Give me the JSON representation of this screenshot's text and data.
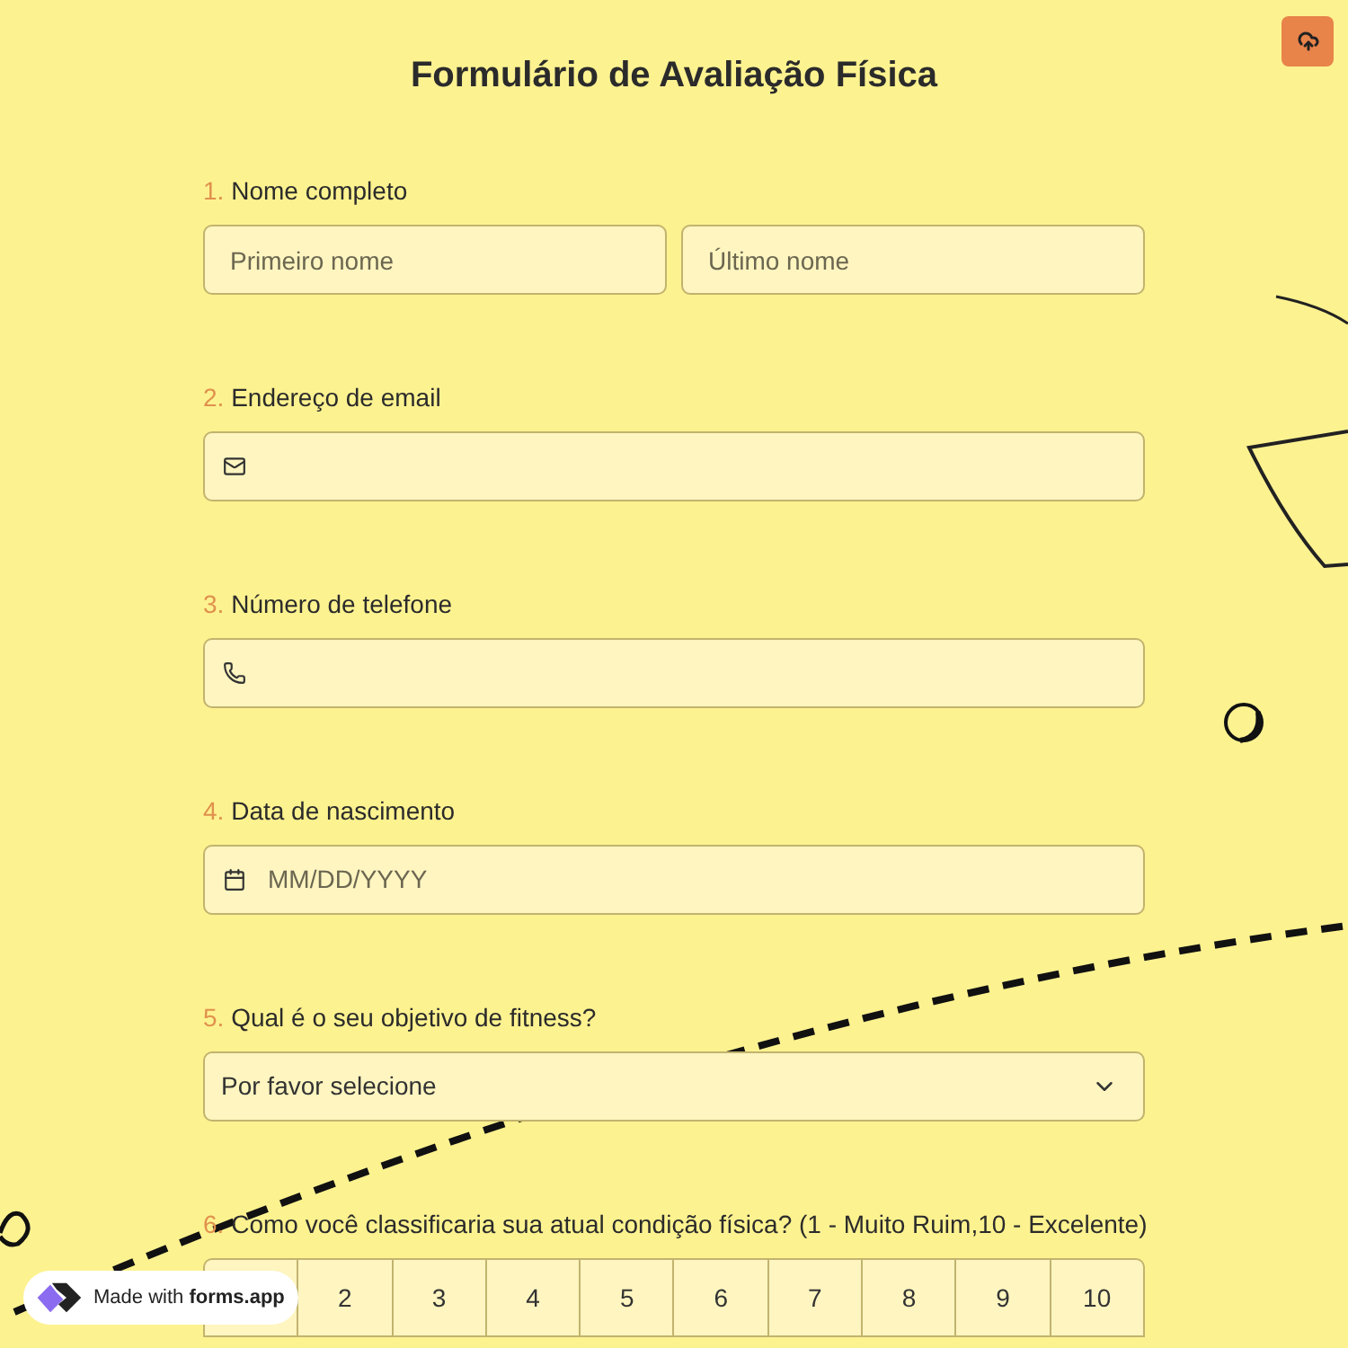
{
  "title": "Formulário de Avaliação Física",
  "questions": [
    {
      "number": "1.",
      "label": "Nome completo",
      "kind": "name",
      "fields": [
        {
          "placeholder": "Primeiro nome"
        },
        {
          "placeholder": "Último nome"
        }
      ]
    },
    {
      "number": "2.",
      "label": "Endereço de email",
      "kind": "email"
    },
    {
      "number": "3.",
      "label": "Número de telefone",
      "kind": "phone"
    },
    {
      "number": "4.",
      "label": "Data de nascimento",
      "kind": "date",
      "placeholder": "MM/DD/YYYY"
    },
    {
      "number": "5.",
      "label": "Qual é o seu objetivo de fitness?",
      "kind": "select",
      "value": "Por favor selecione"
    },
    {
      "number": "6.",
      "label": "Como você classificaria sua atual condição física? (1 - Muito Ruim,10 - Excelente)",
      "kind": "scale",
      "options": [
        "2",
        "3",
        "4",
        "5",
        "6",
        "7",
        "8",
        "9",
        "10"
      ]
    }
  ],
  "badge": {
    "prefix": "Made with",
    "brand": "forms.app"
  }
}
